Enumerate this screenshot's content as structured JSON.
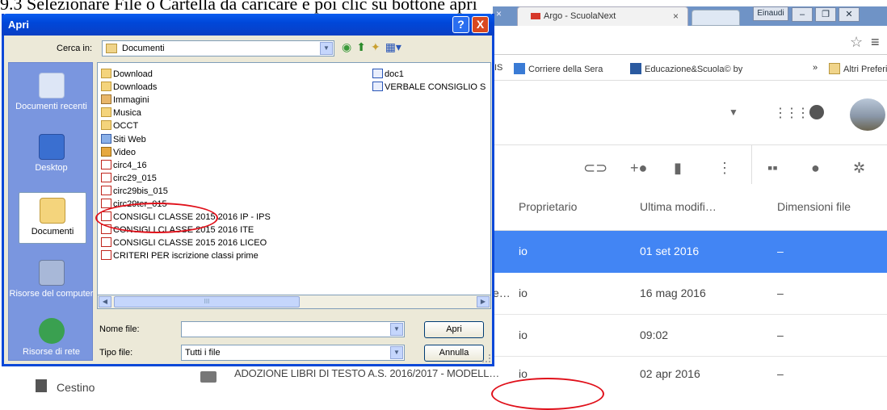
{
  "caption": "9.3 Selezionare File o Cartella da caricare e poi clic su bottone apri",
  "browser": {
    "tab_title": "Argo - ScuolaNext",
    "user_badge": "Einaudi",
    "bookmarks": {
      "b0": "IS",
      "b1": "Corriere della Sera",
      "b2": "Educazione&Scuola© by",
      "more": "»",
      "b3": "Altri Preferit"
    },
    "columns": {
      "owner": "Proprietario",
      "modified": "Ultima modifi…",
      "size": "Dimensioni file"
    },
    "rows": [
      {
        "prefix": "",
        "owner": "io",
        "date": "01 set 2016",
        "size": "–"
      },
      {
        "prefix": "e…",
        "owner": "io",
        "date": "16 mag 2016",
        "size": "–"
      },
      {
        "prefix": "",
        "owner": "io",
        "date": "09:02",
        "size": "–"
      }
    ],
    "bottom_row": {
      "name": "ADOZIONE LIBRI DI TESTO A.S. 2016/2017 - MODELL…",
      "owner": "io",
      "date": "02 apr 2016",
      "size": "–"
    },
    "sidebar_trash": "Cestino"
  },
  "dialog": {
    "title": "Apri",
    "help": "?",
    "close": "X",
    "look_in_label": "Cerca in:",
    "look_in_value": "Documenti",
    "places": {
      "recent": "Documenti recenti",
      "desktop": "Desktop",
      "documents": "Documenti",
      "computer": "Risorse del computer",
      "network": "Risorse di rete"
    },
    "files_col1": [
      {
        "name": "Download",
        "type": "folder"
      },
      {
        "name": "Downloads",
        "type": "folder"
      },
      {
        "name": "Immagini",
        "type": "img"
      },
      {
        "name": "Musica",
        "type": "music"
      },
      {
        "name": "OCCT",
        "type": "folder"
      },
      {
        "name": "Siti Web",
        "type": "web"
      },
      {
        "name": "Video",
        "type": "video"
      },
      {
        "name": "circ4_16",
        "type": "pdf"
      },
      {
        "name": "circ29_015",
        "type": "pdf"
      },
      {
        "name": "circ29bis_015",
        "type": "pdf"
      },
      {
        "name": "circ29ter_015",
        "type": "pdf"
      },
      {
        "name": "CONSIGLI CLASSE 2015 2016 IP - IPS",
        "type": "pdf"
      },
      {
        "name": "CONSIGLI CLASSE 2015 2016 ITE",
        "type": "pdf"
      },
      {
        "name": "CONSIGLI CLASSE 2015 2016 LICEO",
        "type": "pdf"
      },
      {
        "name": "CRITERI PER iscrizione classi prime",
        "type": "pdf"
      }
    ],
    "files_col2": [
      {
        "name": "doc1",
        "type": "word"
      },
      {
        "name": "VERBALE CONSIGLIO S",
        "type": "word"
      }
    ],
    "scroll_thumb": "III",
    "filename_label": "Nome file:",
    "filename_value": "",
    "filetype_label": "Tipo file:",
    "filetype_value": "Tutti i file",
    "open_button": "Apri",
    "cancel_button": "Annulla"
  }
}
